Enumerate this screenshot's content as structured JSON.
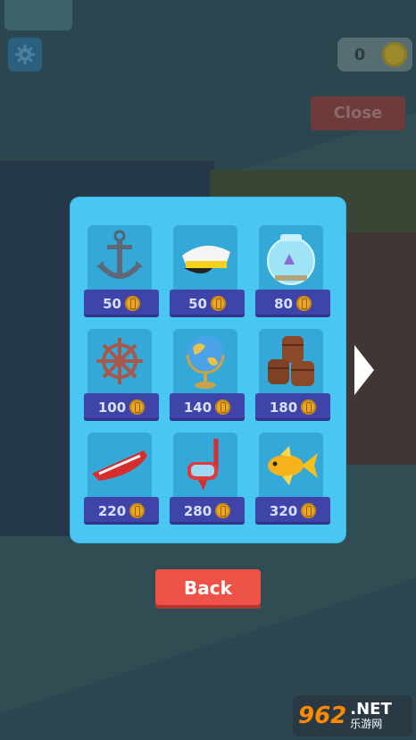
{
  "hud": {
    "coins": "0",
    "close_label": "Close",
    "gear_icon": "gear-icon"
  },
  "shop": {
    "items": [
      {
        "icon": "anchor-icon",
        "price": "50"
      },
      {
        "icon": "captain-hat-icon",
        "price": "50"
      },
      {
        "icon": "fishbowl-icon",
        "price": "80"
      },
      {
        "icon": "ship-wheel-icon",
        "price": "100"
      },
      {
        "icon": "globe-icon",
        "price": "140"
      },
      {
        "icon": "barrels-icon",
        "price": "180"
      },
      {
        "icon": "rowboat-icon",
        "price": "220"
      },
      {
        "icon": "snorkel-mask-icon",
        "price": "280"
      },
      {
        "icon": "goldfish-icon",
        "price": "320"
      }
    ],
    "next_arrow_icon": "chevron-right-icon"
  },
  "footer": {
    "back_label": "Back"
  },
  "watermark": {
    "main": "962",
    "net": ".NET",
    "sub": "乐游网"
  },
  "colors": {
    "panel": "#49c6f2",
    "card": "#34a9d8",
    "price_bar": "#3f45a8",
    "coin": "#e9a825",
    "back_button": "#ee5146"
  }
}
